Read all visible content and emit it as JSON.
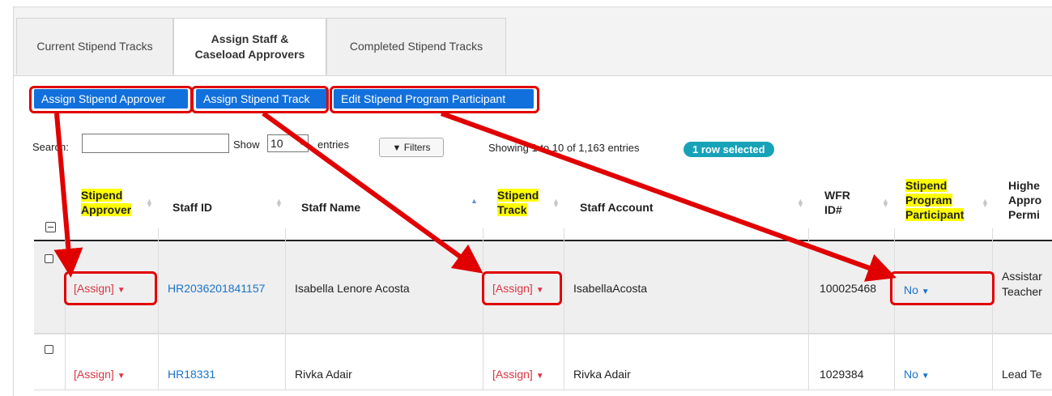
{
  "tabs": [
    {
      "label": "Current Stipend Tracks"
    },
    {
      "label_line1": "Assign Staff &",
      "label_line2": "Caseload Approvers"
    },
    {
      "label": "Completed Stipend Tracks"
    }
  ],
  "actions": {
    "assign_approver": "Assign Stipend Approver",
    "assign_track": "Assign Stipend Track",
    "edit_participant": "Edit Stipend Program Participant"
  },
  "controls": {
    "search_label": "Search:",
    "search_value": "",
    "show_label": "Show",
    "page_size": "10",
    "entries_label": "entries",
    "filters_label": "Filters",
    "info": "Showing 1 to 10 of 1,163 entries",
    "selected_badge": "1 row selected"
  },
  "columns": {
    "approver_l1": "Stipend",
    "approver_l2": "Approver",
    "staff_id": "Staff ID",
    "staff_name": "Staff Name",
    "track_l1": "Stipend",
    "track_l2": "Track",
    "staff_account": "Staff Account",
    "wfr_l1": "WFR",
    "wfr_l2": "ID#",
    "participant_l1": "Stipend",
    "participant_l2": "Program",
    "participant_l3": "Participant",
    "highest_l1": "Highe",
    "highest_l2": "Appro",
    "highest_l3": "Permi"
  },
  "rows": [
    {
      "approver": "[Assign]",
      "staff_id": "HR2036201841157",
      "staff_name": "Isabella Lenore Acosta",
      "track": "[Assign]",
      "staff_account": "IsabellaAcosta",
      "wfr_id": "100025468",
      "participant": "No",
      "highest_l1": "Assistar",
      "highest_l2": "Teacher",
      "selected": true
    },
    {
      "approver": "[Assign]",
      "staff_id": "HR18331",
      "staff_name": "Rivka Adair",
      "track": "[Assign]",
      "staff_account": "Rivka Adair",
      "wfr_id": "1029384",
      "participant": "No",
      "highest_l1": "Lead Te",
      "highest_l2": "",
      "selected": false
    }
  ],
  "colors": {
    "accent": "#1170dc",
    "annotation": "#e00000",
    "highlight": "#ffff00",
    "badge": "#17a2b8",
    "assign": "#dc3545",
    "link": "#1a73c8"
  },
  "icons": {
    "filter": "filter-icon",
    "caret": "caret-down-icon",
    "sort": "sort-icon"
  }
}
